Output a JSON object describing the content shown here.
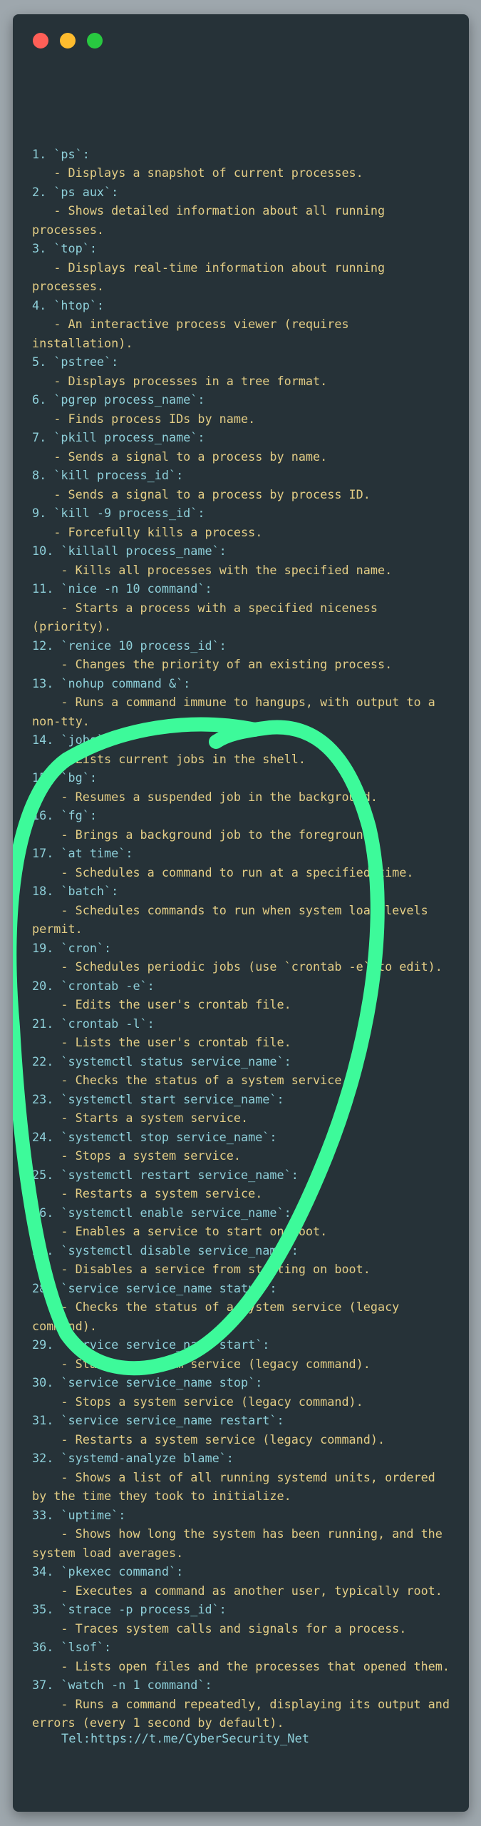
{
  "window": {
    "controls": [
      {
        "name": "close-dot",
        "color": "#ff5f57"
      },
      {
        "name": "minimize-dot",
        "color": "#febc2e"
      },
      {
        "name": "maximize-dot",
        "color": "#28c840"
      }
    ]
  },
  "entries": [
    {
      "cmd": "1. `ps`:",
      "desc": "   - Displays a snapshot of current processes."
    },
    {
      "cmd": "2. `ps aux`:",
      "desc": "   - Shows detailed information about all running processes."
    },
    {
      "cmd": "3. `top`:",
      "desc": "   - Displays real-time information about running processes."
    },
    {
      "cmd": "4. `htop`:",
      "desc": "   - An interactive process viewer (requires installation)."
    },
    {
      "cmd": "5. `pstree`:",
      "desc": "   - Displays processes in a tree format."
    },
    {
      "cmd": "6. `pgrep process_name`:",
      "desc": "   - Finds process IDs by name."
    },
    {
      "cmd": "7. `pkill process_name`:",
      "desc": "   - Sends a signal to a process by name."
    },
    {
      "cmd": "8. `kill process_id`:",
      "desc": "   - Sends a signal to a process by process ID."
    },
    {
      "cmd": "9. `kill -9 process_id`:",
      "desc": "   - Forcefully kills a process."
    },
    {
      "cmd": "10. `killall process_name`:",
      "desc": "    - Kills all processes with the specified name."
    },
    {
      "cmd": "11. `nice -n 10 command`:",
      "desc": "    - Starts a process with a specified niceness (priority)."
    },
    {
      "cmd": "12. `renice 10 process_id`:",
      "desc": "    - Changes the priority of an existing process."
    },
    {
      "cmd": "13. `nohup command &`:",
      "desc": "    - Runs a command immune to hangups, with output to a non-tty."
    },
    {
      "cmd": "14. `jobs`:",
      "desc": "    - Lists current jobs in the shell."
    },
    {
      "cmd": "15. `bg`:",
      "desc": "    - Resumes a suspended job in the background."
    },
    {
      "cmd": "16. `fg`:",
      "desc": "    - Brings a background job to the foreground."
    },
    {
      "cmd": "17. `at time`:",
      "desc": "    - Schedules a command to run at a specified time."
    },
    {
      "cmd": "18. `batch`:",
      "desc": "    - Schedules commands to run when system load levels permit."
    },
    {
      "cmd": "19. `cron`:",
      "desc": "    - Schedules periodic jobs (use `crontab -e` to edit)."
    },
    {
      "cmd": "20. `crontab -e`:",
      "desc": "    - Edits the user's crontab file."
    },
    {
      "cmd": "21. `crontab -l`:",
      "desc": "    - Lists the user's crontab file."
    },
    {
      "cmd": "22. `systemctl status service_name`:",
      "desc": "    - Checks the status of a system service."
    },
    {
      "cmd": "23. `systemctl start service_name`:",
      "desc": "    - Starts a system service."
    },
    {
      "cmd": "24. `systemctl stop service_name`:",
      "desc": "    - Stops a system service."
    },
    {
      "cmd": "25. `systemctl restart service_name`:",
      "desc": "    - Restarts a system service."
    },
    {
      "cmd": "26. `systemctl enable service_name`:",
      "desc": "    - Enables a service to start on boot."
    },
    {
      "cmd": "27. `systemctl disable service_name`:",
      "desc": "    - Disables a service from starting on boot."
    },
    {
      "cmd": "28. `service service_name status`:",
      "desc": "    - Checks the status of a system service (legacy command)."
    },
    {
      "cmd": "29. `service service_name start`:",
      "desc": "    - Starts a system service (legacy command)."
    },
    {
      "cmd": "30. `service service_name stop`:",
      "desc": "    - Stops a system service (legacy command)."
    },
    {
      "cmd": "31. `service service_name restart`:",
      "desc": "    - Restarts a system service (legacy command)."
    },
    {
      "cmd": "32. `systemd-analyze blame`:",
      "desc": "    - Shows a list of all running systemd units, ordered by the time they took to initialize."
    },
    {
      "cmd": "33. `uptime`:",
      "desc": "    - Shows how long the system has been running, and the system load averages."
    },
    {
      "cmd": "34. `pkexec command`:",
      "desc": "    - Executes a command as another user, typically root."
    },
    {
      "cmd": "35. `strace -p process_id`:",
      "desc": "    - Traces system calls and signals for a process."
    },
    {
      "cmd": "36. `lsof`:",
      "desc": "    - Lists open files and the processes that opened them."
    },
    {
      "cmd": "37. `watch -n 1 command`:",
      "desc": "    - Runs a command repeatedly, displaying its output and errors (every 1 second by default)."
    }
  ],
  "footer": {
    "text": "Tel:https://t.me/CyberSecurity_Net"
  },
  "colors": {
    "command": "#8ecfd9",
    "description": "#e3cd85",
    "background": "#263238",
    "annotation": "#3dfa9a"
  }
}
